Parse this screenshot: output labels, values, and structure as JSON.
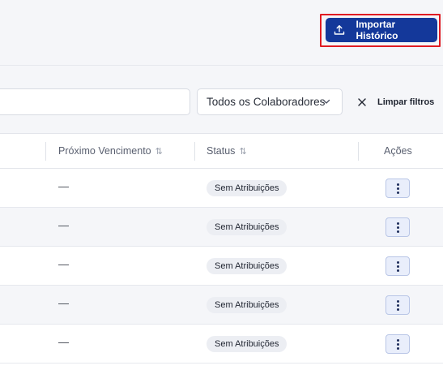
{
  "header": {
    "import_button": {
      "label": "Importar Histórico",
      "icon": "upload-icon",
      "bg_color": "#14389a",
      "highlight_color": "#e01b22"
    }
  },
  "filters": {
    "search": {
      "value": "",
      "placeholder": ""
    },
    "collaborator_select": {
      "value": "Todos os Colaboradores",
      "icon": "chevron-down-icon"
    },
    "clear_filters": {
      "label": "Limpar filtros",
      "icon": "close-icon"
    }
  },
  "table": {
    "columns": [
      {
        "label": "Próximo Vencimento",
        "sort_icon": "⇅"
      },
      {
        "label": "Status",
        "sort_icon": "⇅"
      },
      {
        "label": "Ações"
      }
    ],
    "rows": [
      {
        "proximo_vencimento": "—",
        "status": "Sem Atribuições"
      },
      {
        "proximo_vencimento": "—",
        "status": "Sem Atribuições"
      },
      {
        "proximo_vencimento": "—",
        "status": "Sem Atribuições"
      },
      {
        "proximo_vencimento": "—",
        "status": "Sem Atribuições"
      },
      {
        "proximo_vencimento": "—",
        "status": "Sem Atribuições"
      }
    ],
    "row_action_icon": "more-vertical-icon"
  }
}
